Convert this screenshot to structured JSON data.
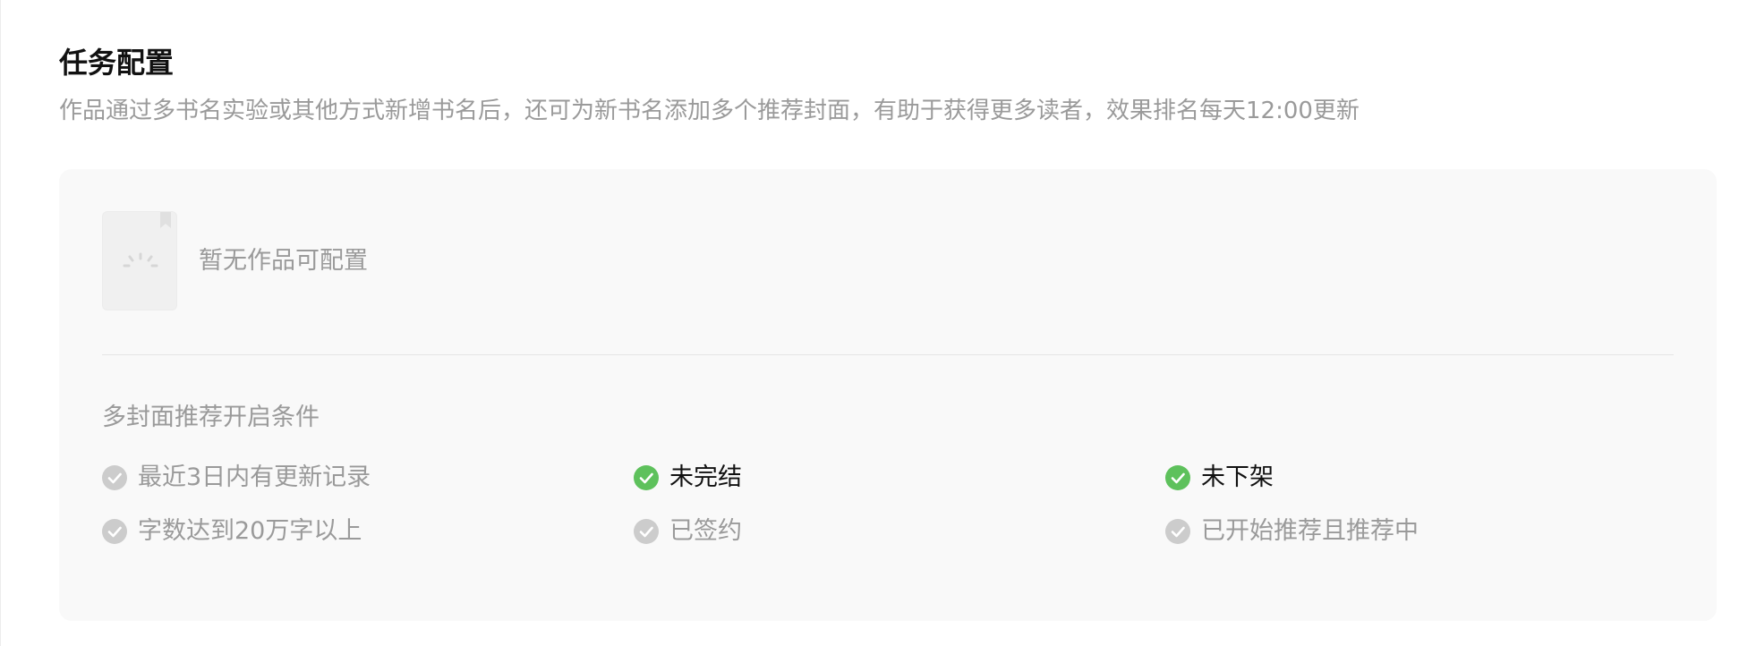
{
  "section": {
    "title": "任务配置",
    "description": "作品通过多书名实验或其他方式新增书名后，还可为新书名添加多个推荐封面，有助于获得更多读者，效果排名每天12:00更新"
  },
  "empty_state": {
    "icon": "book-placeholder-icon",
    "text": "暂无作品可配置"
  },
  "conditions": {
    "title": "多封面推荐开启条件",
    "met_color": "#5ec15c",
    "unmet_color": "#cccccc",
    "items": [
      {
        "label": "最近3日内有更新记录",
        "met": false
      },
      {
        "label": "未完结",
        "met": true
      },
      {
        "label": "未下架",
        "met": true
      },
      {
        "label": "字数达到20万字以上",
        "met": false
      },
      {
        "label": "已签约",
        "met": false
      },
      {
        "label": "已开始推荐且推荐中",
        "met": false
      }
    ]
  }
}
